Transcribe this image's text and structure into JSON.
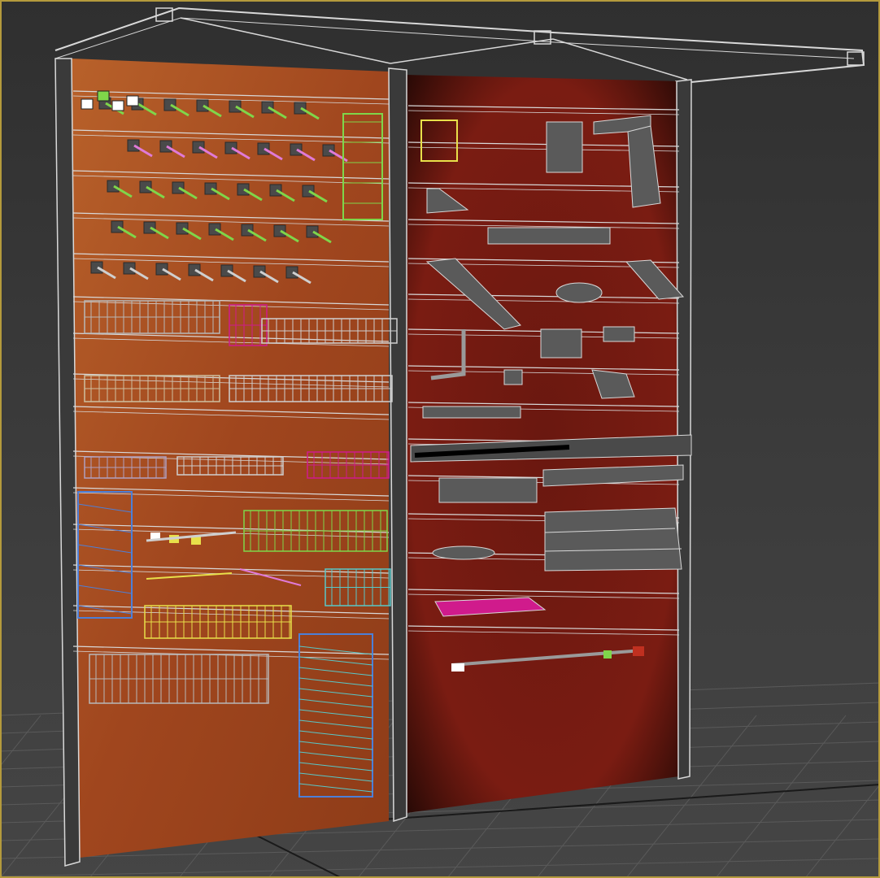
{
  "viewport": {
    "label": "",
    "background_color": "#3a3a3a",
    "active_border_color": "#b49a3c",
    "grid_color": "#5a5a5a",
    "wireframe_color": "#d8d8d8"
  },
  "scene": {
    "object": "slatwall-display-unit",
    "left_panel": {
      "texture_color": "#a0461e",
      "slat_rows": 15,
      "accessories": [
        "hooks",
        "wire-baskets",
        "shelves",
        "racks"
      ]
    },
    "right_panel": {
      "texture_color": "#7a1c12",
      "slat_rows": 15,
      "accessories": [
        "brackets",
        "shelves",
        "trays",
        "bins",
        "magenta-tray"
      ]
    },
    "highlight_colors": {
      "green": "#7fd64a",
      "magenta": "#d01b8c",
      "pink": "#e07ad8",
      "blue": "#4c7fd8",
      "cyan": "#58c8c8",
      "yellow": "#e8e04a",
      "gray_part": "#5a5a5a"
    }
  }
}
